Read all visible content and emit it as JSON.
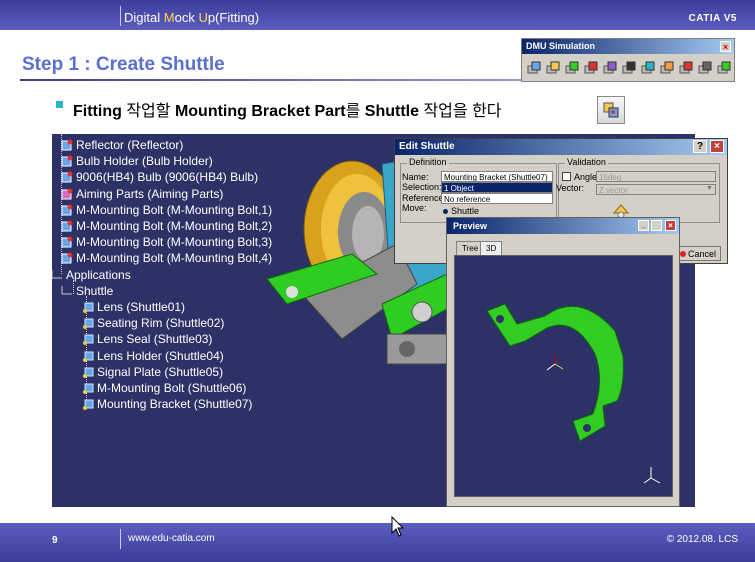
{
  "header": {
    "title_parts": [
      "Digital ",
      "M",
      "ock ",
      "U",
      "p(Fitting)"
    ],
    "brand": "CATIA V5"
  },
  "slide": {
    "step_title": "Step 1 : Create Shuttle",
    "instruction": {
      "b1": "Fitting",
      "t1": " 작업할 ",
      "b2": "Mounting Bracket Part",
      "t2": "를 ",
      "b3": "Shuttle",
      "t3": " 작업을 한다"
    }
  },
  "toolbar": {
    "title": "DMU Simulation",
    "close": "×",
    "icons": [
      "shuttle-icon",
      "scene-icon",
      "track-icon",
      "clash-icon",
      "sequence-icon",
      "player-icon",
      "simulation-icon",
      "speed-icon",
      "swept-volume-icon",
      "trace-icon",
      "edit-icon"
    ]
  },
  "tree": {
    "items": [
      {
        "label": "Reflector (Reflector)",
        "type": "part"
      },
      {
        "label": "Bulb Holder (Bulb Holder)",
        "type": "part"
      },
      {
        "label": "9006(HB4) Bulb (9006(HB4) Bulb)",
        "type": "part"
      },
      {
        "label": "Aiming Parts (Aiming Parts)",
        "type": "product"
      },
      {
        "label": "M-Mounting Bolt (M-Mounting Bolt,1)",
        "type": "part"
      },
      {
        "label": "M-Mounting Bolt (M-Mounting Bolt,2)",
        "type": "part"
      },
      {
        "label": "M-Mounting Bolt (M-Mounting Bolt,3)",
        "type": "part"
      },
      {
        "label": "M-Mounting Bolt (M-Mounting Bolt,4)",
        "type": "part"
      },
      {
        "label": "Applications",
        "type": "app"
      },
      {
        "label": "Shuttle",
        "type": "app"
      },
      {
        "label": "Lens (Shuttle01)",
        "type": "shuttle"
      },
      {
        "label": "Seating Rim (Shuttle02)",
        "type": "shuttle"
      },
      {
        "label": "Lens Seal (Shuttle03)",
        "type": "shuttle"
      },
      {
        "label": "Lens Holder (Shuttle04)",
        "type": "shuttle"
      },
      {
        "label": "Signal Plate (Shuttle05)",
        "type": "shuttle"
      },
      {
        "label": "M-Mounting Bolt (Shuttle06)",
        "type": "shuttle"
      },
      {
        "label": "Mounting Bracket (Shuttle07)",
        "type": "shuttle"
      }
    ]
  },
  "edit_shuttle": {
    "title": "Edit Shuttle",
    "help": "?",
    "close": "×",
    "definition_label": "Definition",
    "name_label": "Name:",
    "name_value": "Mounting Bracket (Shuttle07)",
    "selection_label": "Selection:",
    "selection_value": "1 Object",
    "reference_label": "Reference:",
    "reference_value": "No reference",
    "move_label": "Move:",
    "move_option": "Shuttle",
    "validation_label": "Validation",
    "angle_label": "Angle:",
    "angle_value": "15deg",
    "vector_label": "Vector:",
    "vector_value": "Z vector",
    "cancel_label": "Cancel"
  },
  "preview": {
    "title": "Preview",
    "tabs": [
      "Tree",
      "3D"
    ]
  },
  "footer": {
    "page": "9",
    "url": "www.edu-catia.com",
    "copyright": "© 2012.08. LCS"
  },
  "colors": {
    "header": "#3b3d97",
    "step_title": "#5b6fd1",
    "viewport": "#2c3166",
    "bracket": "#33cc22"
  }
}
